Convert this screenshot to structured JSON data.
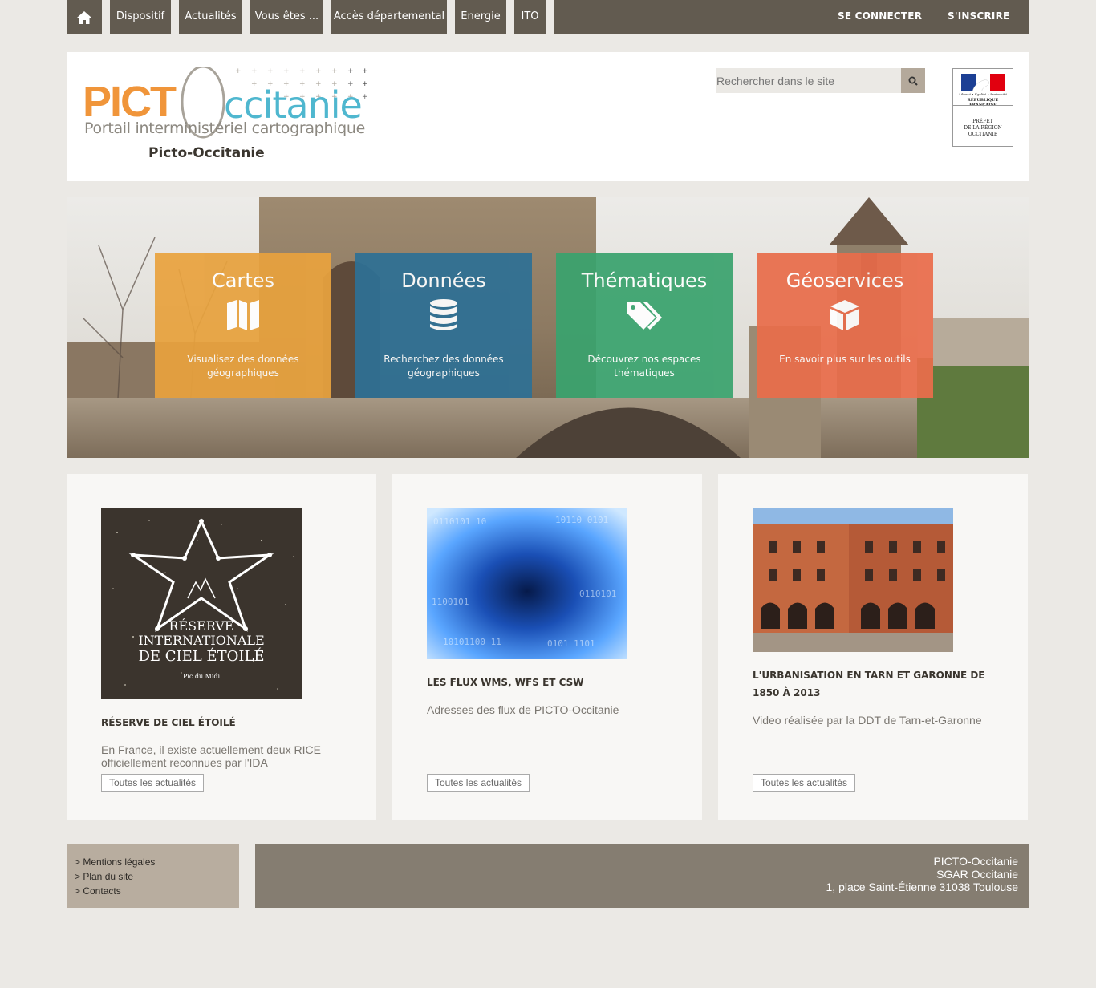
{
  "nav": {
    "items": [
      "Dispositif",
      "Actualités",
      "Vous êtes ...",
      "Accès départemental",
      "Energie",
      "ITO"
    ],
    "login": "SE CONNECTER",
    "register": "S'INSCRIRE"
  },
  "header": {
    "logo_pict": "PICT",
    "logo_occitanie": "ccitanie",
    "logo_subtitle": "Portail interministériel cartographique",
    "site_name": "Picto-Occitanie",
    "search_placeholder": "Rechercher dans le site",
    "prefect": {
      "motto": "Liberté • Égalité • Fraternité",
      "republic": "RÉPUBLIQUE FRANÇAISE",
      "line1": "PRÉFET",
      "line2": "DE LA RÉGION",
      "line3": "OCCITANIE"
    }
  },
  "tiles": [
    {
      "title": "Cartes",
      "desc": "Visualisez des données géographiques",
      "color": "#e8a23e",
      "icon": "map-icon"
    },
    {
      "title": "Données",
      "desc": "Recherchez des données géographiques",
      "color": "#2e7095",
      "icon": "database-icon"
    },
    {
      "title": "Thématiques",
      "desc": "Découvrez nos espaces thématiques",
      "color": "#3aa36e",
      "icon": "tags-icon"
    },
    {
      "title": "Géoservices",
      "desc": "En savoir plus sur les outils",
      "color": "#e96d4b",
      "icon": "cube-icon"
    }
  ],
  "news": [
    {
      "title": "Réserve de ciel étoilé",
      "text": "En France, il existe actuellement deux RICE officiellement reconnues par l'IDA",
      "button": "Toutes les actualités",
      "image_text": {
        "line1": "RÉSERVE",
        "line2": "INTERNATIONALE",
        "line3": "DE CIEL ÉTOILÉ",
        "line4": "Pic du Midi"
      }
    },
    {
      "title": "Les flux WMS, WFS et CSW",
      "text": "Adresses des flux de PICTO-Occitanie",
      "button": "Toutes les actualités"
    },
    {
      "title": "L'urbanisation en Tarn et Garonne de 1850 à 2013",
      "text": "Video réalisée par la DDT de Tarn-et-Garonne",
      "button": "Toutes les actualités"
    }
  ],
  "footer": {
    "links": [
      "> Mentions légales",
      "> Plan du site",
      "> Contacts"
    ],
    "address": [
      "PICTO-Occitanie",
      "SGAR Occitanie",
      "1, place Saint-Étienne 31038 Toulouse"
    ]
  },
  "colors": {
    "nav_bg": "#625b50",
    "page_bg": "#ebe9e5",
    "logo_orange": "#f0953a",
    "logo_teal": "#4fb7cf",
    "footer_links_bg": "#b8ad9f",
    "footer_addr_bg": "#857d71"
  }
}
